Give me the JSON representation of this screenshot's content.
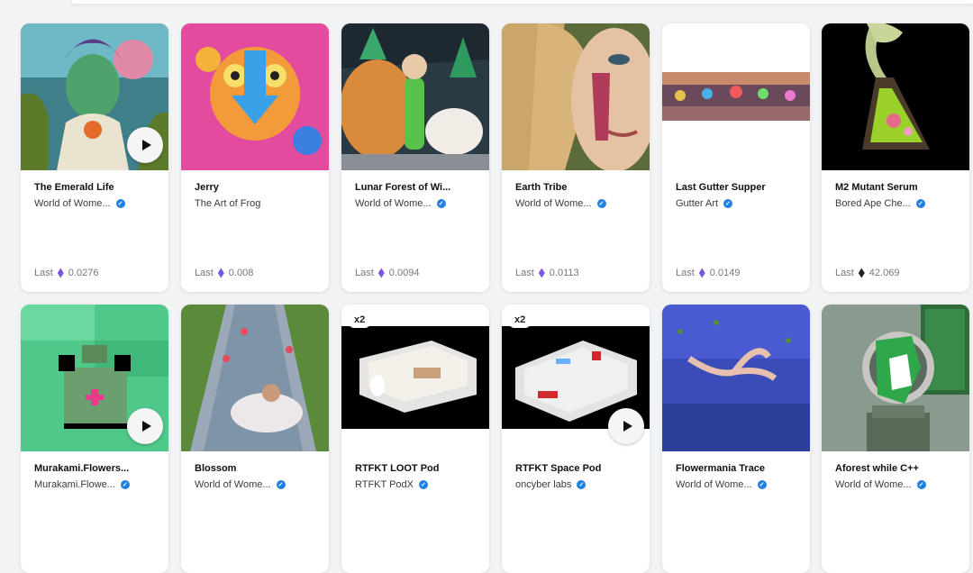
{
  "colors": {
    "verified": "#2081e2",
    "eth_purple": "#7b57e0",
    "eth_black": "#222222"
  },
  "cards": [
    {
      "title": "The Emerald Life",
      "collection": "World of Wome...",
      "verified": true,
      "price_label": "Last",
      "price": "0.0276",
      "eth_color": "purple",
      "has_play": true,
      "badge": ""
    },
    {
      "title": "Jerry",
      "collection": "The Art of Frog",
      "verified": false,
      "price_label": "Last",
      "price": "0.008",
      "eth_color": "purple",
      "has_play": false,
      "badge": ""
    },
    {
      "title": "Lunar Forest of Wi...",
      "collection": "World of Wome...",
      "verified": true,
      "price_label": "Last",
      "price": "0.0094",
      "eth_color": "purple",
      "has_play": false,
      "badge": ""
    },
    {
      "title": "Earth Tribe",
      "collection": "World of Wome...",
      "verified": true,
      "price_label": "Last",
      "price": "0.0113",
      "eth_color": "purple",
      "has_play": false,
      "badge": ""
    },
    {
      "title": "Last Gutter Supper",
      "collection": "Gutter Art",
      "verified": true,
      "price_label": "Last",
      "price": "0.0149",
      "eth_color": "purple",
      "has_play": false,
      "badge": ""
    },
    {
      "title": "M2 Mutant Serum",
      "collection": "Bored Ape Che...",
      "verified": true,
      "price_label": "Last",
      "price": "42.069",
      "eth_color": "black",
      "has_play": false,
      "badge": ""
    },
    {
      "title": "Murakami.Flowers...",
      "collection": "Murakami.Flowe...",
      "verified": true,
      "price_label": "",
      "price": "",
      "eth_color": "",
      "has_play": true,
      "badge": ""
    },
    {
      "title": "Blossom",
      "collection": "World of Wome...",
      "verified": true,
      "price_label": "",
      "price": "",
      "eth_color": "",
      "has_play": false,
      "badge": ""
    },
    {
      "title": "RTFKT LOOT Pod",
      "collection": "RTFKT PodX",
      "verified": true,
      "price_label": "",
      "price": "",
      "eth_color": "",
      "has_play": false,
      "badge": "x2"
    },
    {
      "title": "RTFKT Space Pod",
      "collection": "oncyber labs",
      "verified": true,
      "price_label": "",
      "price": "",
      "eth_color": "",
      "has_play": true,
      "badge": "x2"
    },
    {
      "title": "Flowermania Trace",
      "collection": "World of Wome...",
      "verified": true,
      "price_label": "",
      "price": "",
      "eth_color": "",
      "has_play": false,
      "badge": ""
    },
    {
      "title": "Aforest while C++",
      "collection": "World of Wome...",
      "verified": true,
      "price_label": "",
      "price": "",
      "eth_color": "",
      "has_play": false,
      "badge": ""
    }
  ]
}
